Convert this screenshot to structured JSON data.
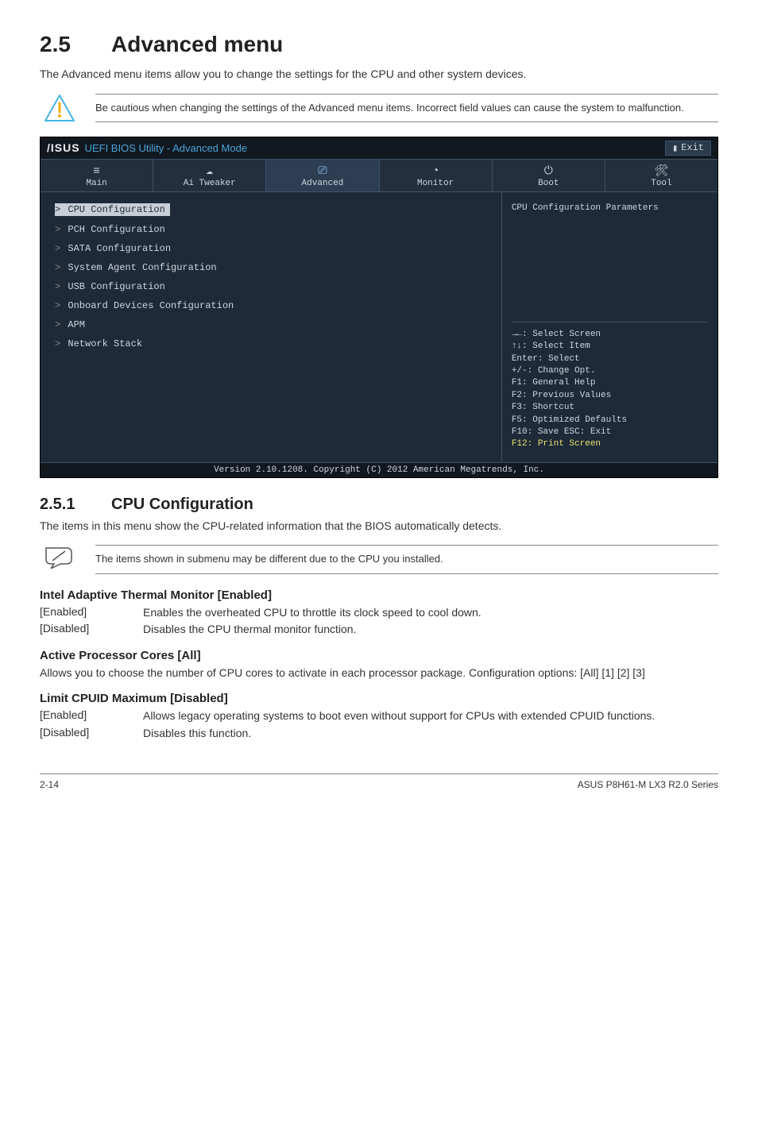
{
  "section": {
    "num": "2.5",
    "title": "Advanced menu"
  },
  "intro": "The Advanced menu items allow you to change the settings for the CPU and other system devices.",
  "warning": "Be cautious when changing the settings of the Advanced menu items. Incorrect field values can cause the system to malfunction.",
  "bios": {
    "logo": "/ISUS",
    "title": "UEFI BIOS Utility - Advanced Mode",
    "exit": "Exit",
    "tabs": [
      {
        "label": "Main"
      },
      {
        "label": "Ai Tweaker"
      },
      {
        "label": "Advanced"
      },
      {
        "label": "Monitor"
      },
      {
        "label": "Boot"
      },
      {
        "label": "Tool"
      }
    ],
    "menu": [
      "CPU Configuration",
      "PCH Configuration",
      "SATA Configuration",
      "System Agent Configuration",
      "USB Configuration",
      "Onboard Devices Configuration",
      "APM",
      "Network Stack"
    ],
    "help_title": "CPU Configuration Parameters",
    "help_keys": [
      "→←: Select Screen",
      "↑↓: Select Item",
      "Enter: Select",
      "+/-: Change Opt.",
      "F1: General Help",
      "F2: Previous Values",
      "F3: Shortcut",
      "F5: Optimized Defaults",
      "F10: Save  ESC: Exit"
    ],
    "help_last": "F12: Print Screen",
    "footer": "Version 2.10.1208. Copyright (C) 2012 American Megatrends, Inc."
  },
  "subsection": {
    "num": "2.5.1",
    "title": "CPU Configuration"
  },
  "sub_intro": "The items in this menu show the CPU-related information that the BIOS automatically detects.",
  "note": "The items shown in submenu may be different due to the CPU you installed.",
  "settings": [
    {
      "title": "Intel Adaptive Thermal Monitor [Enabled]",
      "opts": [
        {
          "k": "[Enabled]",
          "v": "Enables the overheated CPU to throttle its clock speed to cool down."
        },
        {
          "k": "[Disabled]",
          "v": "Disables the CPU thermal monitor function."
        }
      ]
    },
    {
      "title": "Active Processor Cores [All]",
      "body": "Allows you to choose the number of CPU cores to activate in each processor package. Configuration options: [All] [1] [2] [3]"
    },
    {
      "title": "Limit CPUID Maximum [Disabled]",
      "opts": [
        {
          "k": "[Enabled]",
          "v": "Allows legacy operating systems to boot even without support for CPUs with extended CPUID functions."
        },
        {
          "k": "[Disabled]",
          "v": "Disables this function."
        }
      ]
    }
  ],
  "footer": {
    "left": "2-14",
    "right": "ASUS P8H61-M LX3 R2.0 Series"
  }
}
